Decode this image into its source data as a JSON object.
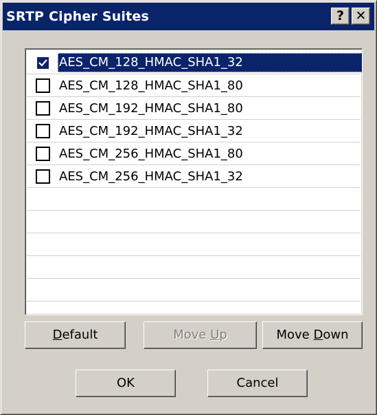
{
  "window": {
    "title": "SRTP Cipher Suites",
    "help_glyph": "?",
    "close_glyph": "✕"
  },
  "list": {
    "items": [
      {
        "label": "AES_CM_128_HMAC_SHA1_32",
        "checked": true,
        "selected": true
      },
      {
        "label": "AES_CM_128_HMAC_SHA1_80",
        "checked": false,
        "selected": false
      },
      {
        "label": "AES_CM_192_HMAC_SHA1_80",
        "checked": false,
        "selected": false
      },
      {
        "label": "AES_CM_192_HMAC_SHA1_32",
        "checked": false,
        "selected": false
      },
      {
        "label": "AES_CM_256_HMAC_SHA1_80",
        "checked": false,
        "selected": false
      },
      {
        "label": "AES_CM_256_HMAC_SHA1_32",
        "checked": false,
        "selected": false
      }
    ],
    "empty_rows": 5
  },
  "buttons": {
    "default": {
      "pre": "",
      "mnemonic": "D",
      "post": "efault",
      "enabled": true
    },
    "move_up": {
      "pre": "Move ",
      "mnemonic": "U",
      "post": "p",
      "enabled": false
    },
    "move_down": {
      "pre": "Move ",
      "mnemonic": "D",
      "post": "own",
      "enabled": true
    },
    "ok": {
      "label": "OK"
    },
    "cancel": {
      "label": "Cancel"
    }
  },
  "colors": {
    "titlebar": "#0a246a",
    "face": "#d4d0c8",
    "selection": "#0a246a"
  }
}
